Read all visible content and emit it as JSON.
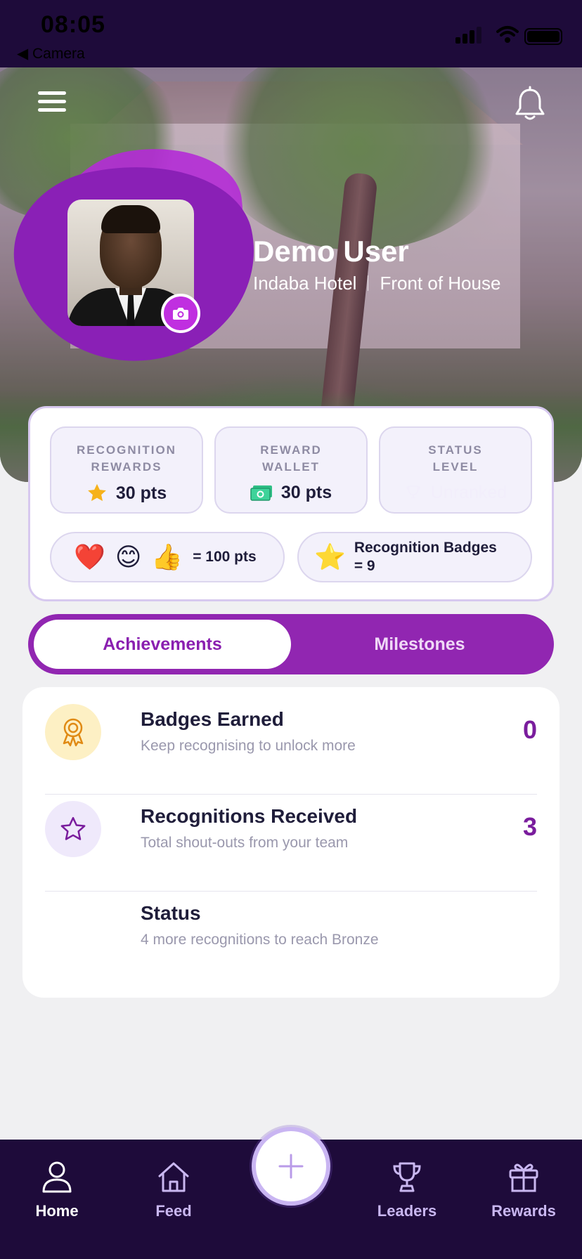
{
  "status_bar": {
    "time": "08:05",
    "back_label": "◀ Camera"
  },
  "header": {
    "menu_icon": "menu-icon",
    "bell_icon": "bell-icon"
  },
  "profile": {
    "name": "Demo User",
    "property": "Indaba Hotel",
    "department": "Front of House"
  },
  "stats": {
    "recognition": {
      "label_line1": "RECOGNITION",
      "label_line2": "REWARDS",
      "value": "30 pts"
    },
    "wallet": {
      "label_line1": "REWARD",
      "label_line2": "WALLET",
      "value": "30 pts"
    },
    "status": {
      "label_line1": "STATUS",
      "label_line2": "LEVEL",
      "value": "Unranked"
    }
  },
  "pills": {
    "reactions": {
      "emojis": [
        "❤️",
        "😊",
        "👍"
      ],
      "text": "= 100 pts"
    },
    "badges": {
      "emoji": "⭐",
      "line1": "Recognition Badges",
      "line2": "= 9"
    }
  },
  "tabs": {
    "active": "Achievements",
    "inactive": "Milestones"
  },
  "achievements": [
    {
      "title": "Badges Earned",
      "subtitle": "Keep recognising to unlock more",
      "count": "0",
      "icon": "award-ribbon-icon"
    },
    {
      "title": "Recognitions Received",
      "subtitle": "Total shout-outs from your team",
      "count": "3",
      "icon": "star-outline-icon"
    },
    {
      "title": "Status",
      "subtitle": "4 more recognitions to reach Bronze",
      "count": "",
      "icon": ""
    }
  ],
  "nav": {
    "items": [
      {
        "label": "Home",
        "icon": "user-icon"
      },
      {
        "label": "Feed",
        "icon": "home-icon"
      },
      {
        "label": "Leaders",
        "icon": "trophy-icon"
      },
      {
        "label": "Rewards",
        "icon": "gift-icon"
      }
    ],
    "fab_icon": "plus-icon"
  },
  "colors": {
    "primary": "#9126b1",
    "dark_nav": "#1e0b3a",
    "count": "#7a1d9d",
    "badge_icon_bg": "#fdf0c4",
    "star_icon_bg": "#efe9fb"
  }
}
